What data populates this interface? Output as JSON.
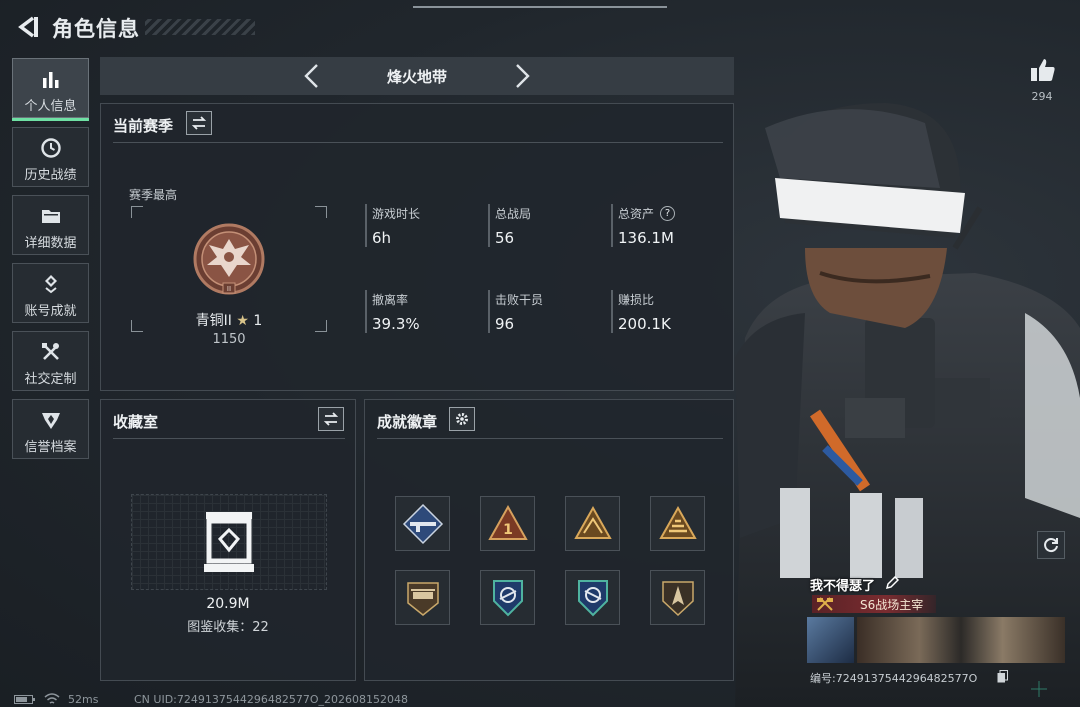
{
  "header": {
    "title": "角色信息",
    "back_icon": "back-arrow-icon"
  },
  "sidebar": {
    "items": [
      {
        "label": "个人信息",
        "icon": "bar-chart-icon",
        "active": true
      },
      {
        "label": "历史战绩",
        "icon": "clock-icon"
      },
      {
        "label": "详细数据",
        "icon": "folder-icon"
      },
      {
        "label": "账号成就",
        "icon": "medal-icon"
      },
      {
        "label": "社交定制",
        "icon": "tools-icon"
      },
      {
        "label": "信誉档案",
        "icon": "shield-crest-icon"
      }
    ]
  },
  "map": {
    "name": "烽火地带"
  },
  "season": {
    "title": "当前赛季",
    "best_label": "赛季最高",
    "rank_name": "青铜II",
    "rank_stars": "1",
    "rank_score": "1150",
    "stats": [
      {
        "label": "游戏时长",
        "value": "6h"
      },
      {
        "label": "总战局",
        "value": "56"
      },
      {
        "label": "总资产",
        "value": "136.1M",
        "help": "?"
      },
      {
        "label": "撤离率",
        "value": "39.3%"
      },
      {
        "label": "击败干员",
        "value": "96"
      },
      {
        "label": "赚损比",
        "value": "200.1K"
      }
    ]
  },
  "collection": {
    "title": "收藏室",
    "value": "20.9M",
    "count_text": "图鉴收集：22"
  },
  "achievements": {
    "title": "成就徽章",
    "badges": [
      "rifle-badge-icon",
      "rank-one-badge-icon",
      "pyramid-badge-icon",
      "stack-badge-icon",
      "helicopter-badge-icon",
      "wing-badge-icon",
      "wing-badge-icon-2",
      "spear-badge-icon"
    ]
  },
  "profile": {
    "likes": "294",
    "player_name": "我不得瑟了",
    "title_tag": "S6战场主宰",
    "id_text": "编号:7249137544296482577O"
  },
  "status_bar": {
    "ping": "52ms",
    "uid": "CN UID:7249137544296482577O_202608152048"
  },
  "colors": {
    "accent": "#6fe0a4",
    "panel": "#20262c",
    "title_tag": "#7a2c30"
  }
}
